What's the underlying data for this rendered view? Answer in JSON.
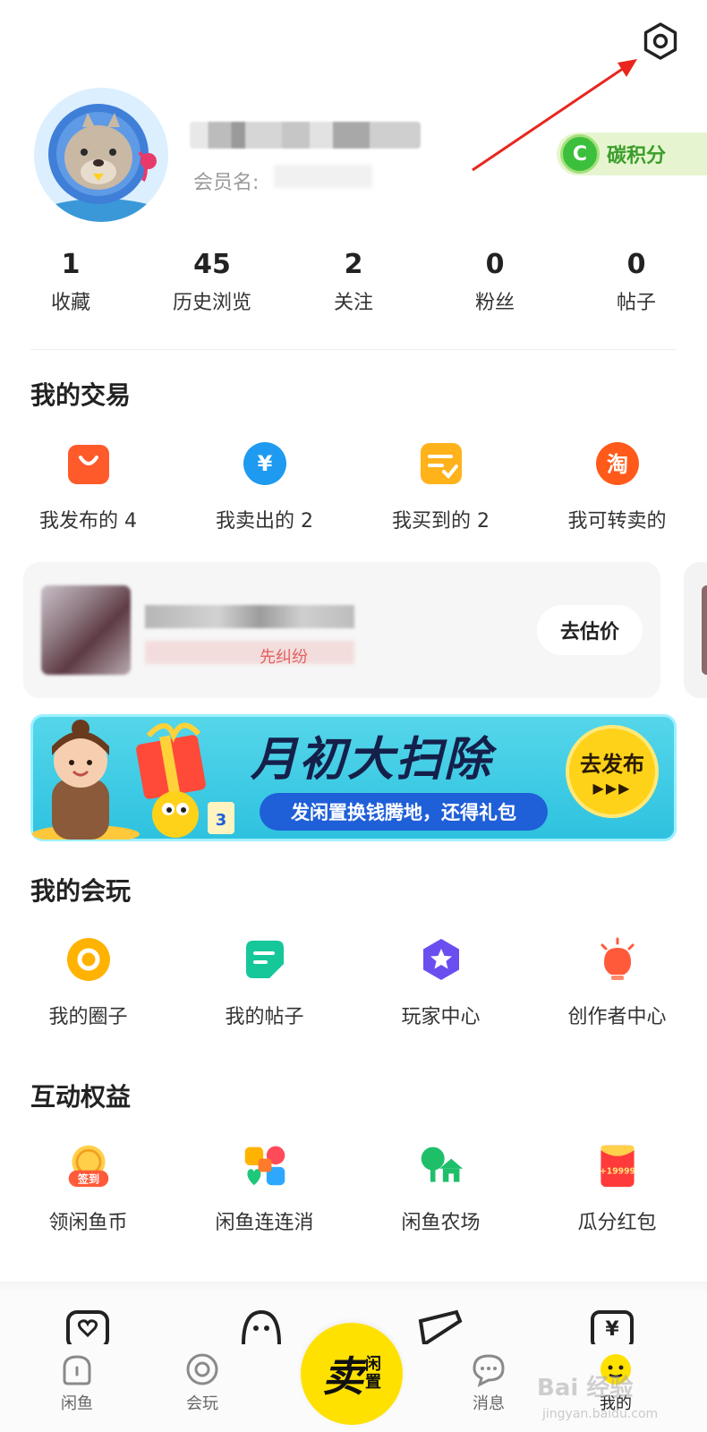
{
  "profile": {
    "member_label": "会员名:",
    "carbon_badge": {
      "icon_letter": "C",
      "label": "碳积分"
    }
  },
  "stats": [
    {
      "value": "1",
      "label": "收藏"
    },
    {
      "value": "45",
      "label": "历史浏览"
    },
    {
      "value": "2",
      "label": "关注"
    },
    {
      "value": "0",
      "label": "粉丝"
    },
    {
      "value": "0",
      "label": "帖子"
    }
  ],
  "trade": {
    "title": "我的交易",
    "items": [
      {
        "label": "我发布的 4",
        "icon": "shopping-bag-icon",
        "color": "#ff5a2a"
      },
      {
        "label": "我卖出的 2",
        "icon": "yen-icon",
        "color": "#1e9bf0"
      },
      {
        "label": "我买到的 2",
        "icon": "check-list-icon",
        "color": "#ffb21a"
      },
      {
        "label": "我可转卖的",
        "icon": "taobao-icon",
        "color": "#ff5a1a"
      }
    ]
  },
  "estimate_card": {
    "subtext": "先纠纷",
    "button_label": "去估价"
  },
  "banner": {
    "title": "月初大扫除",
    "subtitle": "发闲置换钱腾地，还得礼包",
    "button_label": "去发布",
    "button_arrows": "▶▶▶"
  },
  "play": {
    "title": "我的会玩",
    "items": [
      {
        "label": "我的圈子",
        "icon": "circle-icon",
        "color": "#ffb300"
      },
      {
        "label": "我的帖子",
        "icon": "post-icon",
        "color": "#16c79a"
      },
      {
        "label": "玩家中心",
        "icon": "star-badge-icon",
        "color": "#6b4ef0"
      },
      {
        "label": "创作者中心",
        "icon": "bulb-icon",
        "color": "#ff5a3a"
      }
    ]
  },
  "benefits": {
    "title": "互动权益",
    "items": [
      {
        "label": "领闲鱼币",
        "icon": "checkin-coin-icon",
        "badge": "签到"
      },
      {
        "label": "闲鱼连连消",
        "icon": "match-game-icon"
      },
      {
        "label": "闲鱼农场",
        "icon": "farm-icon"
      },
      {
        "label": "瓜分红包",
        "icon": "red-packet-icon",
        "badge": "+19999"
      }
    ]
  },
  "bottom_nav": {
    "items": [
      {
        "label": "闲鱼",
        "icon": "home-icon"
      },
      {
        "label": "会玩",
        "icon": "play-icon"
      },
      {
        "label": "消息",
        "icon": "message-icon"
      },
      {
        "label": "我的",
        "icon": "profile-icon"
      }
    ],
    "sell": {
      "big": "卖",
      "small_1": "闲",
      "small_2": "置"
    }
  },
  "watermark": {
    "text": "Bai 经验",
    "url": "jingyan.baidu.com"
  },
  "colors": {
    "accent_yellow": "#ffe100",
    "carbon_green": "#3cbf3c",
    "arrow_red": "#e8261e"
  }
}
